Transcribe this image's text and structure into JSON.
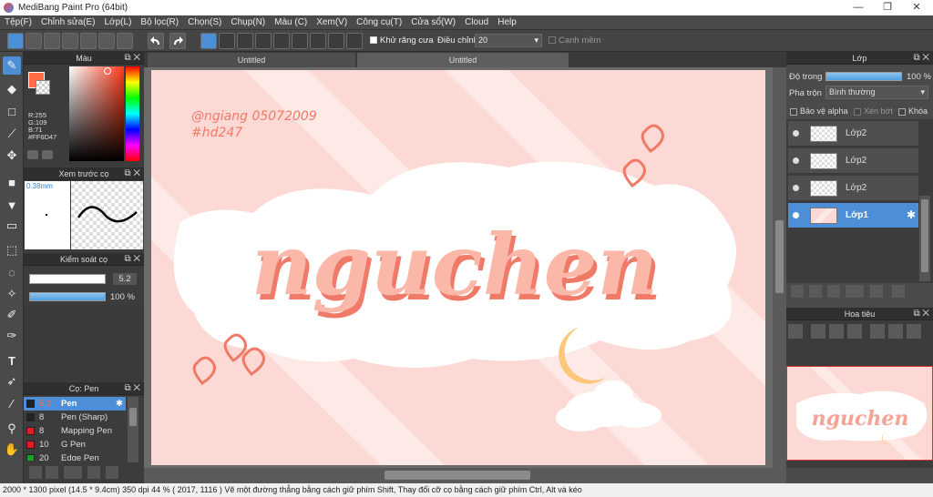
{
  "window": {
    "title": "MediBang Paint Pro (64bit)",
    "minimize": "—",
    "maximize": "❐",
    "close": "✕"
  },
  "menu": [
    "Tệp(F)",
    "Chỉnh sửa(E)",
    "Lớp(L)",
    "Bộ lọc(R)",
    "Chọn(S)",
    "Chụp(N)",
    "Màu (C)",
    "Xem(V)",
    "Công cụ(T)",
    "Cửa sổ(W)",
    "Cloud",
    "Help"
  ],
  "toolbar": {
    "antialias_label": "Khử răng cưa",
    "correction_label": "Điều chỉnh",
    "correction_value": "20",
    "smooth_label": "Cạnh mềm"
  },
  "color_panel": {
    "title": "Màu",
    "r": "R:255",
    "g": "G:109",
    "b": "B:71",
    "hex": "#FF6D47",
    "primary_color": "#FF6D47"
  },
  "preview_panel": {
    "title": "Xem trước cọ",
    "size": "0.38mm"
  },
  "brush_control": {
    "title": "Kiểm soát cọ",
    "size_value": "5.2",
    "opacity_value": "100 %"
  },
  "brush_panel": {
    "title": "Cọ: Pen",
    "items": [
      {
        "size": "5.2",
        "name": "Pen",
        "color": "#222222",
        "selected": true
      },
      {
        "size": "8",
        "name": "Pen (Sharp)",
        "color": "#222222",
        "selected": false
      },
      {
        "size": "8",
        "name": "Mapping Pen",
        "color": "#e02020",
        "selected": false
      },
      {
        "size": "10",
        "name": "G Pen",
        "color": "#e02020",
        "selected": false
      },
      {
        "size": "20",
        "name": "Edge Pen",
        "color": "#20a020",
        "selected": false
      }
    ]
  },
  "tabs": [
    "Untitled",
    "Untitled"
  ],
  "canvas": {
    "watermark_line1": "@ngiang 05072009",
    "watermark_line2": "#hd247",
    "main_word": "nguchen"
  },
  "layer_panel": {
    "title": "Lớp",
    "opacity_label": "Độ trong",
    "opacity_value": "100 %",
    "blend_label": "Pha trộn",
    "blend_value": "Bình thường",
    "alpha_label": "Bảo vệ alpha",
    "clip_label": "Xén bớt",
    "lock_label": "Khóa",
    "layers": [
      {
        "name": "Lớp2",
        "selected": false
      },
      {
        "name": "Lớp2",
        "selected": false
      },
      {
        "name": "Lớp2",
        "selected": false
      },
      {
        "name": "Lớp1",
        "selected": true
      }
    ]
  },
  "navigator": {
    "title": "Hoa tiêu",
    "preview_word": "nguchen"
  },
  "status": "2000 * 1300 pixel   (14.5 * 9.4cm)   350 dpi   44 %   ( 2017, 1116 )   Vẽ một đường thẳng bằng cách giữ phím Shift, Thay đổi cỡ cọ bằng cách giữ phím Ctrl, Alt và kéo"
}
